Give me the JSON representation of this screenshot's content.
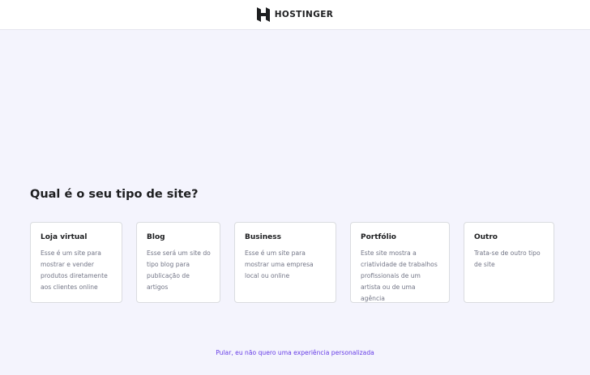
{
  "header": {
    "logo_text": "HOSTINGER",
    "logo_icon": "hostinger-logo"
  },
  "main": {
    "title": "Qual é o seu tipo de site?",
    "cards": [
      {
        "title": "Loja virtual",
        "lines": [
          "Esse é um site para",
          "mostrar e vender",
          "produtos diretamente",
          "aos clientes online"
        ]
      },
      {
        "title": "Blog",
        "lines": [
          "Esse será um site do",
          "tipo blog para",
          "publicação de",
          "artigos"
        ]
      },
      {
        "title": "Business",
        "lines": [
          "Esse é um site para",
          "mostrar uma empresa",
          "local ou online"
        ]
      },
      {
        "title": "Portfólio",
        "lines": [
          "Este site mostra a",
          "criatividade de trabalhos",
          "profissionais de um",
          "artista ou de uma agência"
        ]
      },
      {
        "title": "Outro",
        "lines": [
          "Trata-se de outro tipo",
          "de site"
        ]
      }
    ],
    "skip_link": "Pular, eu não quero uma experiência personalizada"
  },
  "colors": {
    "background": "#f4f4fd",
    "card_background": "#ffffff",
    "accent": "#673de6",
    "text_dark": "#1d1e20",
    "text_muted": "#727586"
  }
}
